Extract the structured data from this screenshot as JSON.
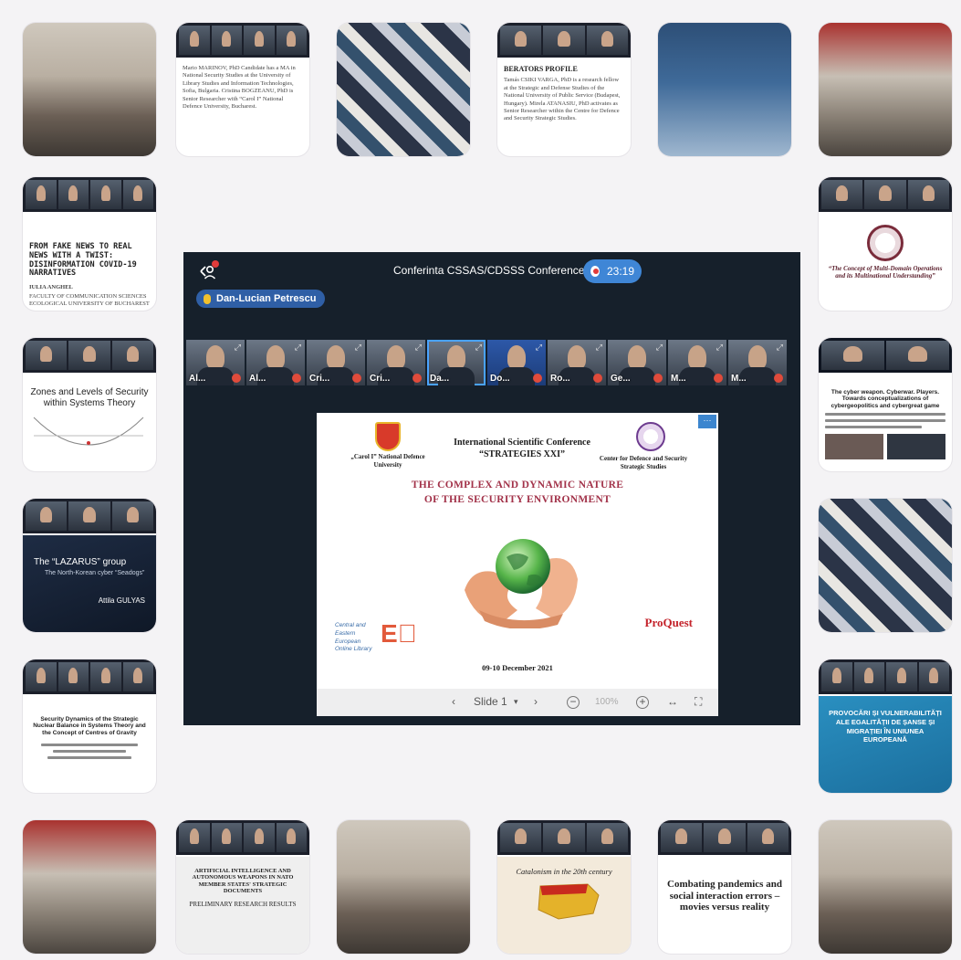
{
  "conference": {
    "title": "Conferinta CSSAS/CDSSS Conference",
    "timer": "23:19",
    "active_speaker": "Dan-Lucian Petrescu",
    "participants": [
      {
        "name": "Al...",
        "muted": true
      },
      {
        "name": "Al...",
        "muted": true
      },
      {
        "name": "Cri...",
        "muted": true
      },
      {
        "name": "Cri...",
        "muted": true
      },
      {
        "name": "Da...",
        "muted": false,
        "active": true
      },
      {
        "name": "Do...",
        "muted": true
      },
      {
        "name": "Ro...",
        "muted": true
      },
      {
        "name": "Ge...",
        "muted": true
      },
      {
        "name": "M...",
        "muted": true
      },
      {
        "name": "M...",
        "muted": true
      }
    ]
  },
  "slide": {
    "ndu_name": "„Carol I” National Defence University",
    "conference_name_line1": "International  Scientific Conference",
    "conference_name_line2": "“STRATEGIES XXI”",
    "cdsss_name": "Center for Defence and Security Strategic Studies",
    "theme_line1": "THE COMPLEX AND DYNAMIC NATURE",
    "theme_line2": "OF THE SECURITY ENVIRONMENT",
    "ceeol_text": "Central and Eastern European Online Library",
    "proquest": "ProQuest",
    "dates": "09-10 December 2021",
    "controls": {
      "slide_label": "Slide 1",
      "zoom": "100%"
    }
  },
  "tiles": {
    "t2_small": "Mario MARINOV, PhD Candidate has a MA in National Security Studies at the University of Library Studies and Information Technologies, Sofia, Bulgaria. Cristina BOGZEANU, PhD is Senior Researcher with “Carol I” National Defence University, Bucharest.",
    "t4_heading": "BERATORS PROFILE",
    "t4_small": "Tamás CSIKI VARGA, PhD is a research fellow at the Strategic and Defense Studies of the National University of Public Service (Budapest, Hungary). Mirela ATANASIU, PhD activates as Senior Researcher within the Centre for Defence and Security Strategic Studies.",
    "fake_news_title": "FROM FAKE NEWS TO REAL NEWS WITH A TWIST: DISINFORMATION COVID-19 NARRATIVES",
    "fake_news_author": "IULIA ANGHEL",
    "fake_news_affil": "FACULTY OF COMMUNICATION SCIENCES ECOLOGICAL UNIVERSITY OF BUCHAREST",
    "multidomain_title": "“The Concept of Multi-Domain Operations and its Multinational Understanding”",
    "zones_title": "Zones and Levels of Security within Systems Theory",
    "cyber_title": "The cyber weapon. Cyberwar. Players. Towards conceptualizations of cybergeopolitics and cybergreat game",
    "lazarus_title": "The “LAZARUS” group",
    "lazarus_sub": "The North-Korean cyber “Seadogs”",
    "lazarus_author": "Attila GULYAS",
    "nuclear_title": "Security Dynamics of the Strategic Nuclear Balance in Systems Theory and the Concept of Centres of Gravity",
    "provocari_title": "PROVOCĂRI ȘI VULNERABILITĂȚI ALE EGALITĂȚII DE ȘANSE ȘI MIGRAȚIEI ÎN UNIUNEA EUROPEANĂ",
    "ai_title": "ARTIFICIAL INTELLIGENCE AND AUTONOMOUS WEAPONS IN NATO MEMBER STATES' STRATEGIC DOCUMENTS",
    "ai_sub": "PRELIMINARY RESEARCH RESULTS",
    "catalonia_title": "Catalonism in the 20th century",
    "pandemics_title": "Combating pandemics and social interaction errors – movies versus reality"
  },
  "colors": {
    "background": "#f4f3f5",
    "conference_bg": "#16202b",
    "accent_blue": "#3f86d6",
    "theme_red": "#a23249"
  },
  "icons": [
    "exit-call-icon",
    "record-icon",
    "microphone-icon",
    "muted-mic-icon",
    "expand-icon",
    "chevron-left-icon",
    "chevron-down-icon",
    "chevron-right-icon",
    "zoom-out-icon",
    "zoom-in-icon",
    "fit-width-icon",
    "fullscreen-icon"
  ]
}
